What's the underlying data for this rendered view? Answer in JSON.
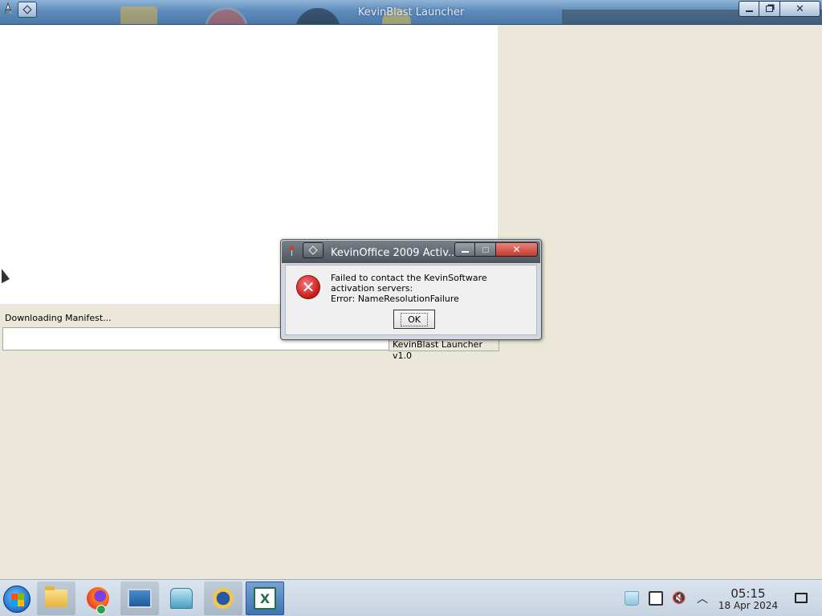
{
  "window": {
    "title": "KevinBlast Launcher",
    "app_icon": "kevinblast-app-icon",
    "menu_icon": "window-menu-icon",
    "status_text": "Downloading Manifest...",
    "progress_fraction": 0,
    "version_label": "KevinBlast Launcher v1.0"
  },
  "dialog": {
    "title": "KevinOffice 2009 Activ...",
    "icon": "error-icon",
    "message_line1": "Failed to contact the KevinSoftware activation servers:",
    "message_line2": "Error: NameResolutionFailure",
    "ok_label": "OK"
  },
  "taskbar": {
    "items": [
      {
        "name": "start-button",
        "icon": "windows-logo-icon"
      },
      {
        "name": "file-manager",
        "icon": "folder-icon"
      },
      {
        "name": "firefox",
        "icon": "firefox-icon"
      },
      {
        "name": "remote-desktop",
        "icon": "monitor-icon"
      },
      {
        "name": "network-tool",
        "icon": "network-icon"
      },
      {
        "name": "kevinblast",
        "icon": "kevinblast-icon"
      },
      {
        "name": "excel",
        "icon": "excel-icon"
      }
    ],
    "tray": [
      "recycle-bin-icon",
      "clipboard-icon",
      "volume-muted-icon",
      "chevron-up-icon"
    ],
    "time": "05:15",
    "date": "18 Apr 2024"
  },
  "colors": {
    "desktop_bg": "#ebe8da",
    "titlebar_blue": "#5f8cbb",
    "dialog_close_red": "#c33a2c",
    "error_red": "#c81818"
  }
}
